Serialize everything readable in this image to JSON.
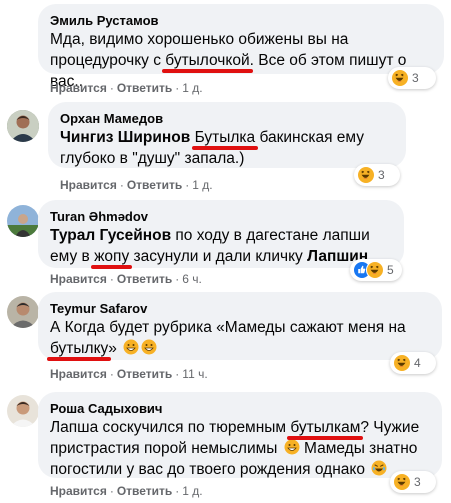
{
  "comments": [
    {
      "author": "Эмиль Рустамов",
      "text_before": "Мда, видимо хорошенько обижены вы на процедурочку с ",
      "underlined": "бутылочкой",
      "text_after": ". Все об этом пишут о вас..",
      "like": "Нравится",
      "reply": "Ответить",
      "time": "1 д.",
      "reaction_count": "3",
      "reaction_icons": [
        "haha-icon"
      ]
    },
    {
      "author": "Орхан Мамедов",
      "mention": "Чингиз Ширинов",
      "underlined": "Бутылка",
      "text_after": " бакинская ему глубоко в \"душу\" запала.)",
      "like": "Нравится",
      "reply": "Ответить",
      "time": "1 д.",
      "reaction_count": "3",
      "reaction_icons": [
        "haha-icon"
      ]
    },
    {
      "author": "Turan Əhmədov",
      "mention": "Турал Гусейнов",
      "text_middle": " по ходу в дагестане лапши ему в ",
      "underlined": "жопу",
      "text_after": " засунули и дали кличку ",
      "mention2": "Лапшин",
      "like": "Нравится",
      "reply": "Ответить",
      "time": "6 ч.",
      "reaction_count": "5",
      "reaction_icons": [
        "like-icon",
        "haha-icon"
      ]
    },
    {
      "author": "Teymur Safarov",
      "text_before": "А Когда будет рубрика «Мамеды сажают меня на ",
      "underlined": "бутылку",
      "text_after": "»",
      "like": "Нравится",
      "reply": "Ответить",
      "time": "11 ч.",
      "reaction_count": "4",
      "reaction_icons": [
        "haha-icon"
      ]
    },
    {
      "author": "Роша Садыхович",
      "text_before": "Лапша соскучился по тюремным ",
      "underlined": "бутылкам",
      "text_after": "? Чужие пристрастия порой немыслимы ",
      "text_after2": " Мамеды знатно погостили у вас до твоего рождения однако ",
      "like": "Нравится",
      "reply": "Ответить",
      "time": "1 д.",
      "reaction_count": "3",
      "reaction_icons": [
        "haha-icon"
      ]
    }
  ],
  "colors": {
    "bubble": "#f0f2f5",
    "underline": "#e01010",
    "meta": "#65676b",
    "like_blue": "#1877f2",
    "haha_yellow": "#f7b125"
  }
}
